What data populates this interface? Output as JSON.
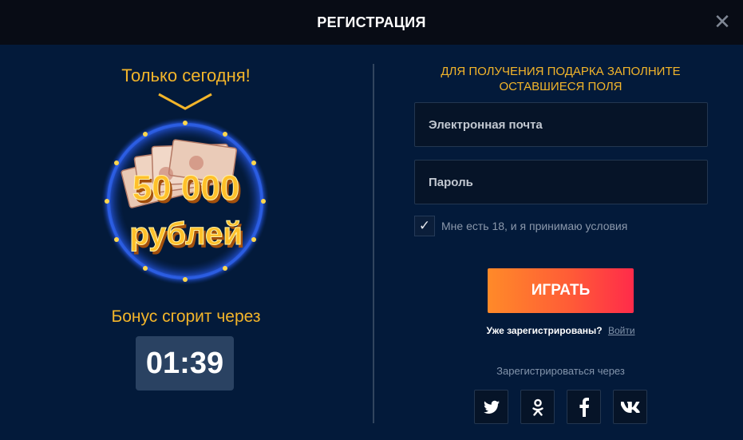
{
  "header": {
    "title": "РЕГИСТРАЦИЯ",
    "close_icon": "close-icon"
  },
  "left": {
    "only_today": "Только сегодня!",
    "prize_amount": "50 000",
    "prize_currency": "рублей",
    "bonus_expires": "Бонус сгорит через",
    "timer": "01:39"
  },
  "form": {
    "promo_text": "ДЛЯ ПОЛУЧЕНИЯ ПОДАРКА ЗАПОЛНИТЕ ОСТАВШИЕСЯ ПОЛЯ",
    "email_placeholder": "Электронная почта",
    "email_value": "",
    "password_placeholder": "Пароль",
    "password_value": "",
    "terms_checked": true,
    "terms_label": "Мне есть 18, и я принимаю условия",
    "play_button": "ИГРАТЬ",
    "already_registered": "Уже зарегистрированы?",
    "login_link": "Войти",
    "register_via": "Зарегистрироваться через"
  },
  "socials": [
    {
      "icon": "twitter-icon"
    },
    {
      "icon": "odnoklassniki-icon"
    },
    {
      "icon": "facebook-icon"
    },
    {
      "icon": "vk-icon"
    }
  ],
  "colors": {
    "accent": "#f3b52a",
    "background": "#031a3a",
    "header": "#080c15",
    "button_start": "#ff8a29",
    "button_end": "#ff2b4a"
  }
}
